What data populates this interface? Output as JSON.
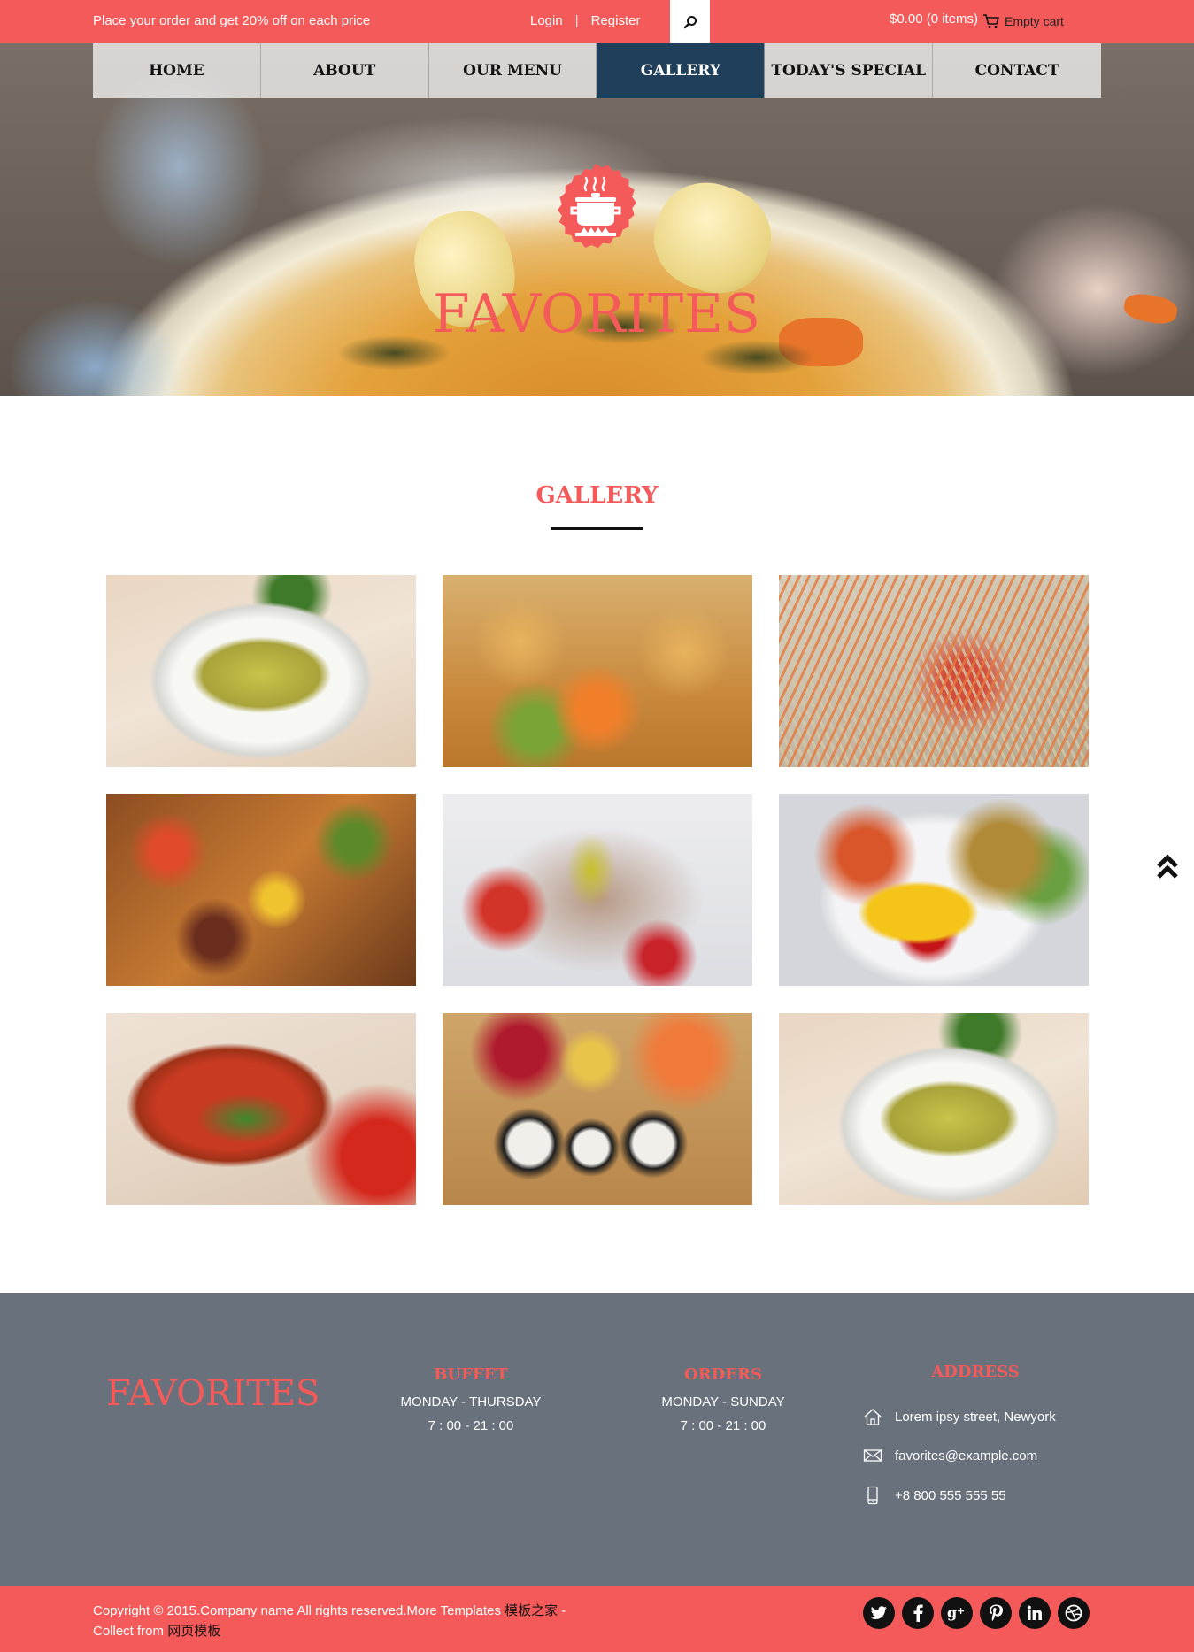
{
  "topbar": {
    "promo": "Place your order and get 20% off on each price",
    "login": "Login",
    "separator": "|",
    "register": "Register",
    "search_icon": "search-icon",
    "cart_total": "$0.00 (0 items)",
    "cart_icon": "cart-icon",
    "cart_label": "Empty cart"
  },
  "nav": {
    "items": [
      {
        "label": "HOME"
      },
      {
        "label": "ABOUT"
      },
      {
        "label": "OUR MENU"
      },
      {
        "label": "GALLERY",
        "active": true
      },
      {
        "label": "TODAY'S SPECIAL"
      },
      {
        "label": "CONTACT"
      }
    ]
  },
  "hero": {
    "badge_icon": "cooking-pot-icon",
    "title": "FAVORITES"
  },
  "gallery": {
    "title": "GALLERY",
    "images": [
      {
        "icon": "soup-bowl-photo"
      },
      {
        "icon": "vol-au-vent-photo"
      },
      {
        "icon": "papaya-salad-photo"
      },
      {
        "icon": "pasta-photo"
      },
      {
        "icon": "seafood-salad-photo"
      },
      {
        "icon": "omelette-rice-photo"
      },
      {
        "icon": "tomato-soup-photo"
      },
      {
        "icon": "sushi-photo"
      },
      {
        "icon": "soup-bowl-photo"
      }
    ]
  },
  "scroll_top_icon": "double-chevron-up-icon",
  "footer": {
    "brand": "FAVORITES",
    "buffet": {
      "heading": "BUFFET",
      "days": "MONDAY - THURSDAY",
      "hours": "7 : 00 - 21 : 00"
    },
    "orders": {
      "heading": "ORDERS",
      "days": "MONDAY - SUNDAY",
      "hours": "7 : 00 - 21 : 00"
    },
    "address": {
      "heading": "ADDRESS",
      "street": "Lorem ipsy street, Newyork",
      "email": "favorites@example.com",
      "phone": "+8 800 555 555 55"
    }
  },
  "bottom": {
    "copyright": "Copyright © 2015.Company name All rights reserved.More Templates ",
    "link1": "模板之家",
    "dash": " - ",
    "collect": "Collect from ",
    "link2": "网页模板",
    "social": [
      "twitter-icon",
      "facebook-icon",
      "google-plus-icon",
      "pinterest-icon",
      "linkedin-icon",
      "dribbble-icon"
    ]
  },
  "colors": {
    "accent": "#f55a5a",
    "nav_active": "#1f3f5a",
    "footer_bg": "#69717c"
  }
}
